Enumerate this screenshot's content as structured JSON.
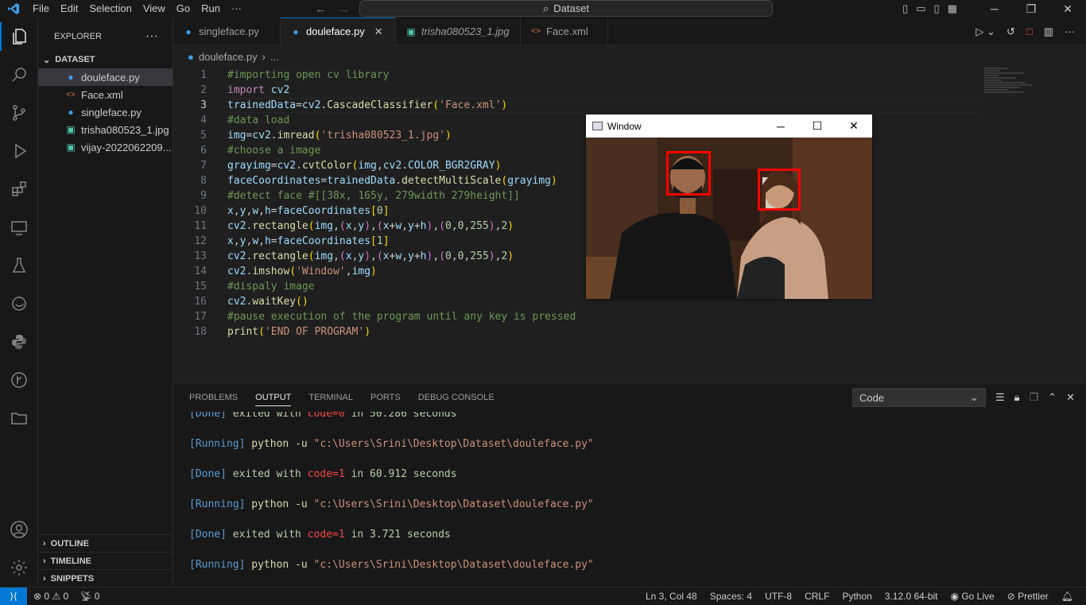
{
  "menu": [
    "File",
    "Edit",
    "Selection",
    "View",
    "Go",
    "Run",
    "···"
  ],
  "search": {
    "label": "Dataset"
  },
  "explorer": {
    "title": "EXPLORER",
    "folder": "DATASET",
    "files": [
      {
        "name": "douleface.py",
        "icon": "python-icon",
        "selected": true
      },
      {
        "name": "Face.xml",
        "icon": "xml-icon",
        "selected": false
      },
      {
        "name": "singleface.py",
        "icon": "python-icon",
        "selected": false
      },
      {
        "name": "trisha080523_1.jpg",
        "icon": "image-icon",
        "selected": false
      },
      {
        "name": "vijay-2022062209...",
        "icon": "image-icon",
        "selected": false
      }
    ],
    "bottom_sections": [
      "OUTLINE",
      "TIMELINE",
      "SNIPPETS"
    ]
  },
  "tabs": [
    {
      "label": "singleface.py",
      "icon": "python-icon",
      "active": false
    },
    {
      "label": "douleface.py",
      "icon": "python-icon",
      "active": true
    },
    {
      "label": "trisha080523_1.jpg",
      "icon": "image-icon",
      "active": false
    },
    {
      "label": "Face.xml",
      "icon": "xml-icon",
      "active": false
    }
  ],
  "breadcrumb": {
    "file": "douleface.py",
    "rest": "..."
  },
  "editor": {
    "current_line": 3,
    "lines": [
      "#importing open cv library",
      "import cv2",
      "trainedData=cv2.CascadeClassifier('Face.xml')",
      "#data load",
      "img=cv2.imread('trisha080523_1.jpg')",
      "#choose a image",
      "grayimg=cv2.cvtColor(img,cv2.COLOR_BGR2GRAY)",
      "faceCoordinates=trainedData.detectMultiScale(grayimg)",
      "#detect face #[[38x, 165y, 279width 279height]]",
      "x,y,w,h=faceCoordinates[0]",
      "cv2.rectangle(img,(x,y),(x+w,y+h),(0,0,255),2)",
      "x,y,w,h=faceCoordinates[1]",
      "cv2.rectangle(img,(x,y),(x+w,y+h),(0,0,255),2)",
      "cv2.imshow('Window',img)",
      "#dispaly image",
      "cv2.waitKey()",
      "#pause execution of the program until any key is pressed",
      "print('END OF PROGRAM')"
    ]
  },
  "window": {
    "title": "Window"
  },
  "panel": {
    "tabs": [
      "PROBLEMS",
      "OUTPUT",
      "TERMINAL",
      "PORTS",
      "DEBUG CONSOLE"
    ],
    "active_tab": "OUTPUT",
    "dropdown": "Code",
    "output": [
      {
        "tag": "[Done]",
        "text": " exited with ",
        "code": "code=0",
        "rest": " in ",
        "num": "50.286",
        "tail": " seconds"
      },
      {
        "tag": "[Running]",
        "cmd": " python -u ",
        "path": "\"c:\\Users\\Srini\\Desktop\\Dataset\\douleface.py\""
      },
      {
        "tag": "[Done]",
        "text": " exited with ",
        "code": "code=1",
        "rest": " in ",
        "num": "60.912",
        "tail": " seconds"
      },
      {
        "tag": "[Running]",
        "cmd": " python -u ",
        "path": "\"c:\\Users\\Srini\\Desktop\\Dataset\\douleface.py\""
      },
      {
        "tag": "[Done]",
        "text": " exited with ",
        "code": "code=1",
        "rest": " in ",
        "num": "3.721",
        "tail": " seconds"
      },
      {
        "tag": "[Running]",
        "cmd": " python -u ",
        "path": "\"c:\\Users\\Srini\\Desktop\\Dataset\\douleface.py\""
      }
    ]
  },
  "status": {
    "errors": "0",
    "warnings": "0",
    "ports": "0",
    "position": "Ln 3, Col 48",
    "spaces": "Spaces: 4",
    "encoding": "UTF-8",
    "eol": "CRLF",
    "language": "Python",
    "version": "3.12.0 64-bit",
    "golive": "Go Live",
    "prettier": "Prettier"
  },
  "colors": {
    "accent": "#0078d4",
    "face_box": "#ff0000"
  }
}
